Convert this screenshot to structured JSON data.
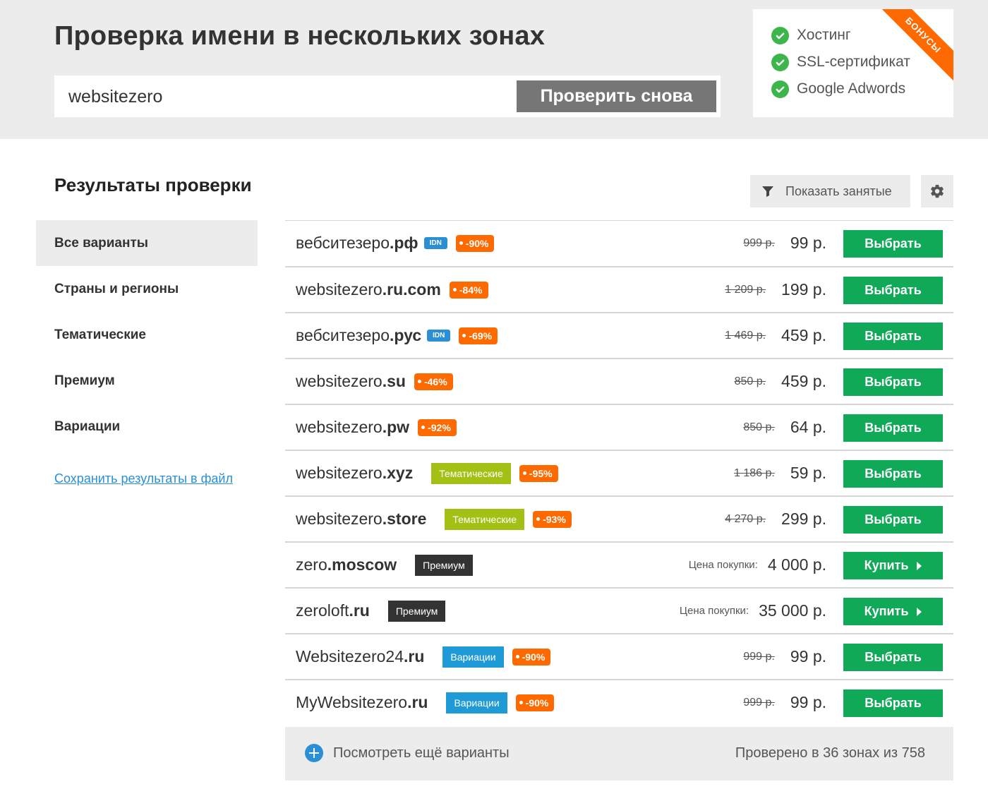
{
  "header": {
    "title": "Проверка имени в нескольких зонах",
    "search_value": "websitezero",
    "check_button": "Проверить снова"
  },
  "bonuses": {
    "ribbon": "БОНУСЫ",
    "items": [
      "Хостинг",
      "SSL-сертификат",
      "Google Adwords"
    ],
    "check_color": "#3cb54a",
    "ribbon_color": "#ff6a00"
  },
  "results": {
    "title": "Результаты проверки",
    "show_taken": "Показать занятые",
    "filter_icon": "filter-icon",
    "settings_icon": "gear-icon"
  },
  "sidebar": {
    "items": [
      "Все варианты",
      "Страны и регионы",
      "Тематические",
      "Премиум",
      "Вариации"
    ],
    "save_link": "Сохранить результаты в файл"
  },
  "domains": [
    {
      "name": "вебситезеро",
      "zone": ".рф",
      "idn": "IDN",
      "category": "",
      "cat_style": "",
      "discount": "-90%",
      "old_price": "999 р.",
      "buy_label": "",
      "price": "99 р.",
      "action": "Выбрать",
      "arrow": false
    },
    {
      "name": "websitezero",
      "zone": ".ru.com",
      "idn": "",
      "category": "",
      "cat_style": "",
      "discount": "-84%",
      "old_price": "1 209 р.",
      "buy_label": "",
      "price": "199 р.",
      "action": "Выбрать",
      "arrow": false
    },
    {
      "name": "вебситезеро",
      "zone": ".рус",
      "idn": "IDN",
      "category": "",
      "cat_style": "",
      "discount": "-69%",
      "old_price": "1 469 р.",
      "buy_label": "",
      "price": "459 р.",
      "action": "Выбрать",
      "arrow": false
    },
    {
      "name": "websitezero",
      "zone": ".su",
      "idn": "",
      "category": "",
      "cat_style": "",
      "discount": "-46%",
      "old_price": "850 р.",
      "buy_label": "",
      "price": "459 р.",
      "action": "Выбрать",
      "arrow": false
    },
    {
      "name": "websitezero",
      "zone": ".pw",
      "idn": "",
      "category": "",
      "cat_style": "",
      "discount": "-92%",
      "old_price": "850 р.",
      "buy_label": "",
      "price": "64 р.",
      "action": "Выбрать",
      "arrow": false
    },
    {
      "name": "websitezero",
      "zone": ".xyz",
      "idn": "",
      "category": "Тематические",
      "cat_style": "green",
      "discount": "-95%",
      "old_price": "1 186 р.",
      "buy_label": "",
      "price": "59 р.",
      "action": "Выбрать",
      "arrow": false
    },
    {
      "name": "websitezero",
      "zone": ".store",
      "idn": "",
      "category": "Тематические",
      "cat_style": "green",
      "discount": "-93%",
      "old_price": "4 270 р.",
      "buy_label": "",
      "price": "299 р.",
      "action": "Выбрать",
      "arrow": false
    },
    {
      "name": "zero",
      "zone": ".moscow",
      "idn": "",
      "category": "Премиум",
      "cat_style": "dark",
      "discount": "",
      "old_price": "",
      "buy_label": "Цена покупки:",
      "price": "4 000 р.",
      "action": "Купить",
      "arrow": true
    },
    {
      "name": "zeroloft",
      "zone": ".ru",
      "idn": "",
      "category": "Премиум",
      "cat_style": "dark",
      "discount": "",
      "old_price": "",
      "buy_label": "Цена покупки:",
      "price": "35 000 р.",
      "action": "Купить",
      "arrow": true
    },
    {
      "name": "Websitezero24",
      "zone": ".ru",
      "idn": "",
      "category": "Вариации",
      "cat_style": "blue",
      "discount": "-90%",
      "old_price": "999 р.",
      "buy_label": "",
      "price": "99 р.",
      "action": "Выбрать",
      "arrow": false
    },
    {
      "name": "MyWebsitezero",
      "zone": ".ru",
      "idn": "",
      "category": "Вариации",
      "cat_style": "blue",
      "discount": "-90%",
      "old_price": "999 р.",
      "buy_label": "",
      "price": "99 р.",
      "action": "Выбрать",
      "arrow": false
    }
  ],
  "footer": {
    "more_link": "Посмотреть ещё варианты",
    "checked_info": "Проверено в 36 зонах из 758"
  },
  "colors": {
    "accent_green": "#0fa957",
    "discount_orange": "#ff6a00",
    "link_blue": "#2a8fd4",
    "thematic_green": "#a3c014",
    "premium_dark": "#333333",
    "variations_blue": "#1e9ad6"
  }
}
